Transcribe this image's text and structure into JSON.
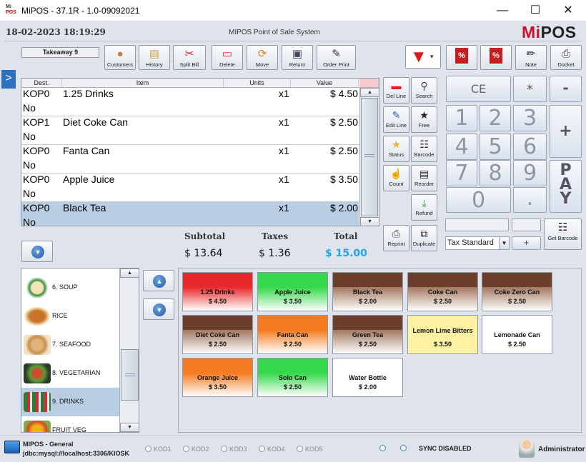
{
  "window": {
    "title": "MiPOS - 37.1R - 1.0-09092021",
    "logo_top": "Mi",
    "logo_bottom": "POS"
  },
  "header": {
    "datetime": "18-02-2023 18:19:29",
    "system_name": "MIPOS Point of Sale System",
    "brand_mi": "Mi",
    "brand_pos": "POS"
  },
  "takeaway": "Takeaway 9",
  "toolbar": [
    "Customers",
    "History",
    "Split Bill",
    "Delete",
    "Move",
    "Return",
    "Order Print"
  ],
  "right_toolbar": [
    "Note",
    "Docket"
  ],
  "order_table": {
    "headers": [
      "Dest.",
      "Item",
      "Units",
      "Value"
    ],
    "rows": [
      {
        "dest": "KOP0",
        "item": "1.25 Drinks",
        "units": "x1",
        "value": "$ 4.50",
        "flag": "No"
      },
      {
        "dest": "KOP1",
        "item": "Diet Coke Can",
        "units": "x1",
        "value": "$ 2.50",
        "flag": "No"
      },
      {
        "dest": "KOP0",
        "item": "Fanta Can",
        "units": "x1",
        "value": "$ 2.50",
        "flag": "No"
      },
      {
        "dest": "KOP0",
        "item": "Apple Juice",
        "units": "x1",
        "value": "$ 3.50",
        "flag": "No"
      },
      {
        "dest": "KOP0",
        "item": "Black Tea",
        "units": "x1",
        "value": "$ 2.00",
        "flag": "No"
      }
    ]
  },
  "totals": {
    "subtotal_label": "Subtotal",
    "taxes_label": "Taxes",
    "total_label": "Total",
    "subtotal": "$ 13.64",
    "taxes": "$ 1.36",
    "total": "$ 15.00"
  },
  "side_buttons": [
    "Del Line",
    "Search",
    "Edit Line",
    "Free",
    "Status",
    "Barcode",
    "Count",
    "Reorder",
    "Refund",
    "Reprint",
    "Duplicate"
  ],
  "keypad": {
    "ce": "CE",
    "mul": "*",
    "minus": "-",
    "plus": "+",
    "digits": [
      "1",
      "2",
      "3",
      "4",
      "5",
      "6",
      "7",
      "8",
      "9",
      "0",
      "."
    ],
    "pay": [
      "P",
      "A",
      "Y"
    ]
  },
  "tax": {
    "selected": "Tax Standard",
    "plus_btn": "+",
    "get_barcode": "Get Barcode"
  },
  "categories": [
    {
      "name": "6. SOUP"
    },
    {
      "name": "RICE"
    },
    {
      "name": "7. SEAFOOD"
    },
    {
      "name": "8. VEGETARIAN"
    },
    {
      "name": "9. DRINKS"
    },
    {
      "name": "FRUIT VEG"
    }
  ],
  "products": [
    {
      "name": "1.25 Drinks",
      "price": "$ 4.50",
      "color": "#e8292c"
    },
    {
      "name": "Apple Juice",
      "price": "$ 3.50",
      "color": "#35d84a"
    },
    {
      "name": "Black Tea",
      "price": "$ 2.00",
      "color": "#6b3f2c"
    },
    {
      "name": "Coke Can",
      "price": "$ 2.50",
      "color": "#6b3f2c"
    },
    {
      "name": "Coke Zero Can",
      "price": "$ 2.50",
      "color": "#6b3f2c"
    },
    {
      "name": "Diet Coke Can",
      "price": "$ 2.50",
      "color": "#6b3f2c"
    },
    {
      "name": "Fanta Can",
      "price": "$ 2.50",
      "color": "#f47b20"
    },
    {
      "name": "Green Tea",
      "price": "$ 2.50",
      "color": "#6b3f2c"
    },
    {
      "name": "Lemon Lime Bitters",
      "price": "$ 3.50",
      "color": "#fff3a3"
    },
    {
      "name": "Lemonade Can",
      "price": "$ 2.50",
      "color": "#ffffff"
    },
    {
      "name": "Orange Juice",
      "price": "$ 3.50",
      "color": "#f47b20"
    },
    {
      "name": "Solo Can",
      "price": "$ 2.50",
      "color": "#35d84a"
    },
    {
      "name": "Water Bottle",
      "price": "$ 2.00",
      "color": "#ffffff"
    }
  ],
  "footer": {
    "app": "MIPOS - General",
    "db": "jdbc:mysql://localhost:3306/KIOSK",
    "kods": [
      "KOD1",
      "KOD2",
      "KOD3",
      "KOD4",
      "KOD5"
    ],
    "sync": "SYNC DISABLED",
    "user": "Administrator"
  }
}
